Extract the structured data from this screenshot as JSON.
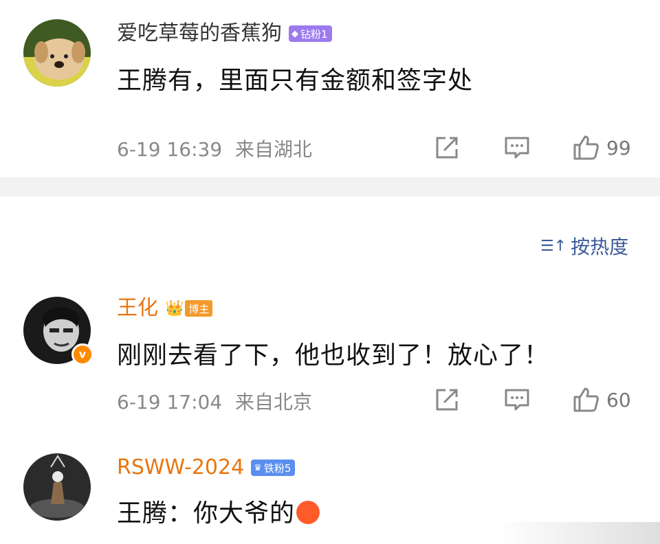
{
  "comments": [
    {
      "username": "爱吃草莓的香蕉狗",
      "badge": "钻粉1",
      "text": "王腾有，里面只有金额和签字处",
      "time": "6-19 16:39",
      "location": "来自湖北",
      "likes": "99"
    },
    {
      "username": "王化",
      "badge": "博主",
      "text": "刚刚去看了下，他也收到了！放心了！",
      "time": "6-19 17:04",
      "location": "来自北京",
      "likes": "60"
    },
    {
      "username": "RSWW-2024",
      "badge": "铁粉5",
      "text": "王腾：你大爷的"
    }
  ],
  "sort_label": "按热度",
  "colors": {
    "link_blue": "#3c5a99",
    "blogger_orange": "#e8760f",
    "divider_gray": "#f2f2f2"
  }
}
